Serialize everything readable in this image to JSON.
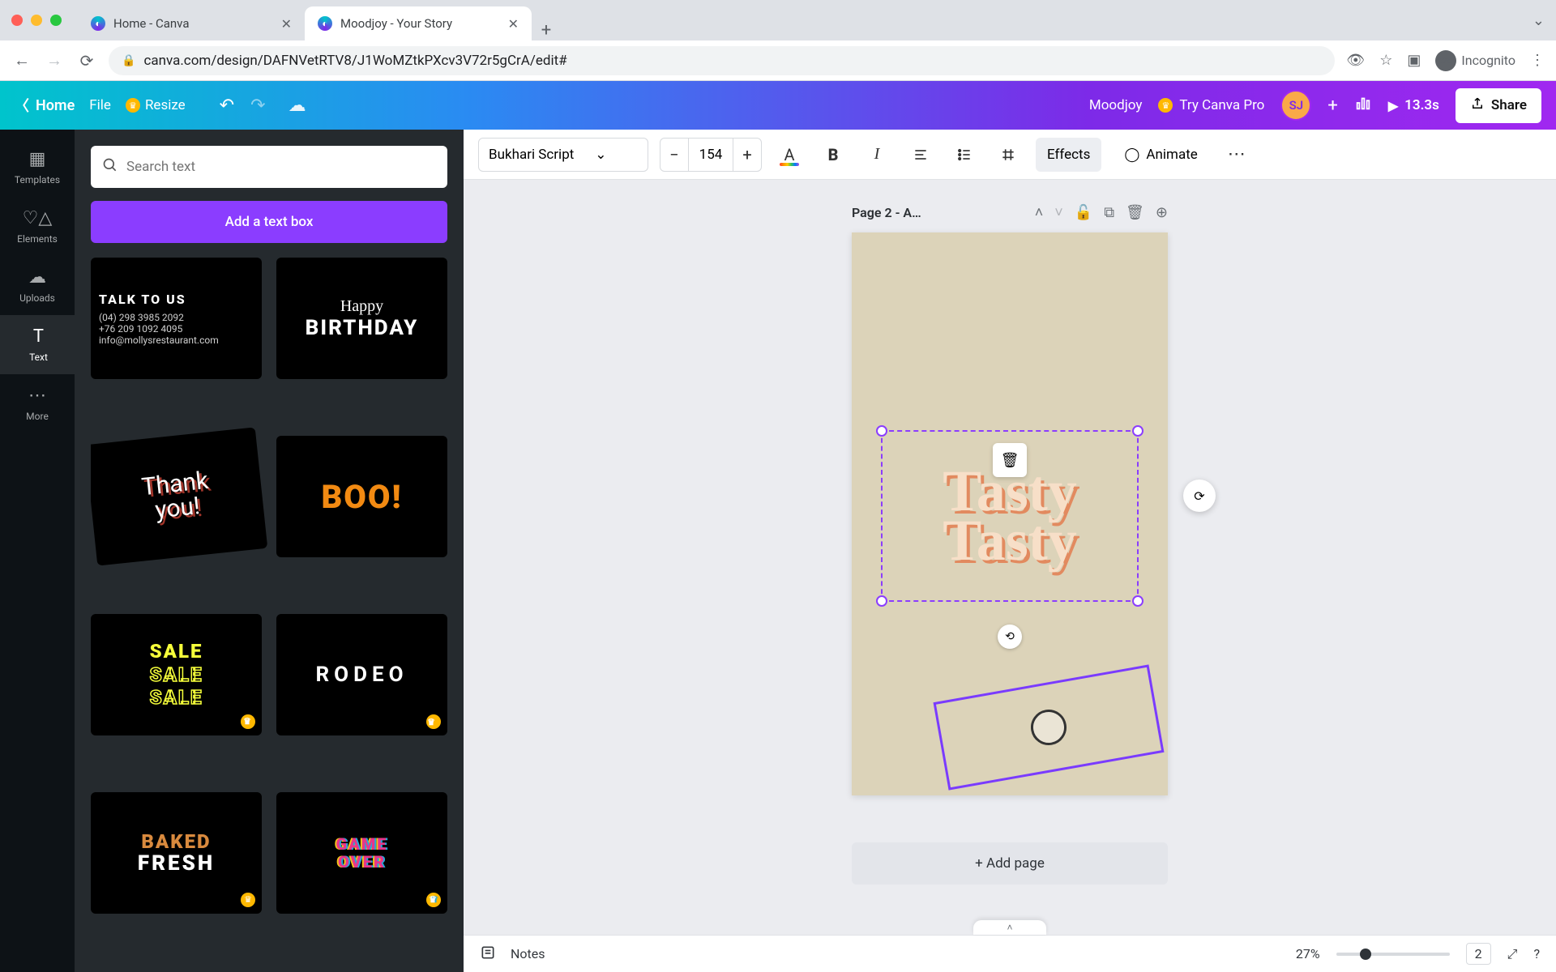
{
  "browser": {
    "tabs": [
      {
        "title": "Home - Canva",
        "active": false
      },
      {
        "title": "Moodjoy - Your Story",
        "active": true
      }
    ],
    "url": "canva.com/design/DAFNVetRTV8/J1WoMZtkPXcv3V72r5gCrA/edit#",
    "incognito_label": "Incognito"
  },
  "topbar": {
    "home": "Home",
    "file": "File",
    "resize": "Resize",
    "doc_name": "Moodjoy",
    "try_pro": "Try Canva Pro",
    "avatar_initials": "SJ",
    "play_duration": "13.3s",
    "share": "Share"
  },
  "rail": {
    "templates": "Templates",
    "elements": "Elements",
    "uploads": "Uploads",
    "text": "Text",
    "more": "More"
  },
  "panel": {
    "search_placeholder": "Search text",
    "add_text": "Add a text box",
    "cards": {
      "talk_title": "TALK TO US",
      "talk_line1": "(04) 298 3985 2092",
      "talk_line2": "+76 209 1092 4095",
      "talk_line3": "info@mollysrestaurant.com",
      "hb_line1": "Happy",
      "hb_line2": "BIRTHDAY",
      "thank": "Thank\nyou!",
      "boo": "BOO!",
      "sale": "SALE",
      "rodeo": "RODEO",
      "baked1": "BAKED",
      "baked2": "FRESH",
      "gameover": "GAME\nOVER"
    }
  },
  "texttoolbar": {
    "font": "Bukhari Script",
    "size": "154",
    "effects": "Effects",
    "animate": "Animate"
  },
  "page": {
    "label": "Page 2 - A…",
    "tasty": "Tasty\nTasty",
    "add_page": "+ Add page"
  },
  "bottom": {
    "notes": "Notes",
    "zoom": "27%",
    "page_number": "2"
  }
}
